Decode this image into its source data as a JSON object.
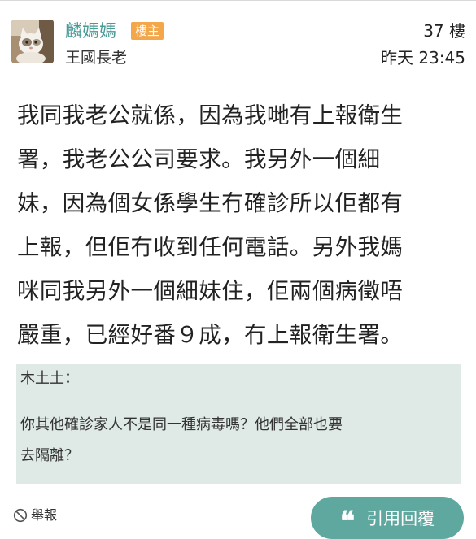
{
  "post": {
    "username": "麟媽媽",
    "op_badge": "樓主",
    "user_rank": "王國長老",
    "floor": "37 樓",
    "time": "昨天 23:45",
    "body_lines": [
      "我同我老公就係，因為我哋有上報衛生",
      "署，我老公公司要求。我另外一個細",
      "妹，因為個女係學生冇確診所以佢都有",
      "上報，但佢冇收到任何電話。另外我媽",
      "咪同我另外一個細妹住，佢兩個病徵唔",
      "嚴重，已經好番９成，冇上報衛生署。"
    ]
  },
  "quote": {
    "author": "木土土：",
    "lines": [
      "你其他確診家人不是同一種病毒嗎？他們全部也要",
      "去隔離？"
    ]
  },
  "actions": {
    "report_label": "舉報",
    "reply_label": "引用回覆",
    "reply_icon": "quote-icon",
    "report_icon": "no-entry-icon"
  },
  "colors": {
    "username": "#4a9a96",
    "op_badge": "#f3a64a",
    "quote_bg": "#dfeae6",
    "reply_button": "#5fa8a0"
  }
}
